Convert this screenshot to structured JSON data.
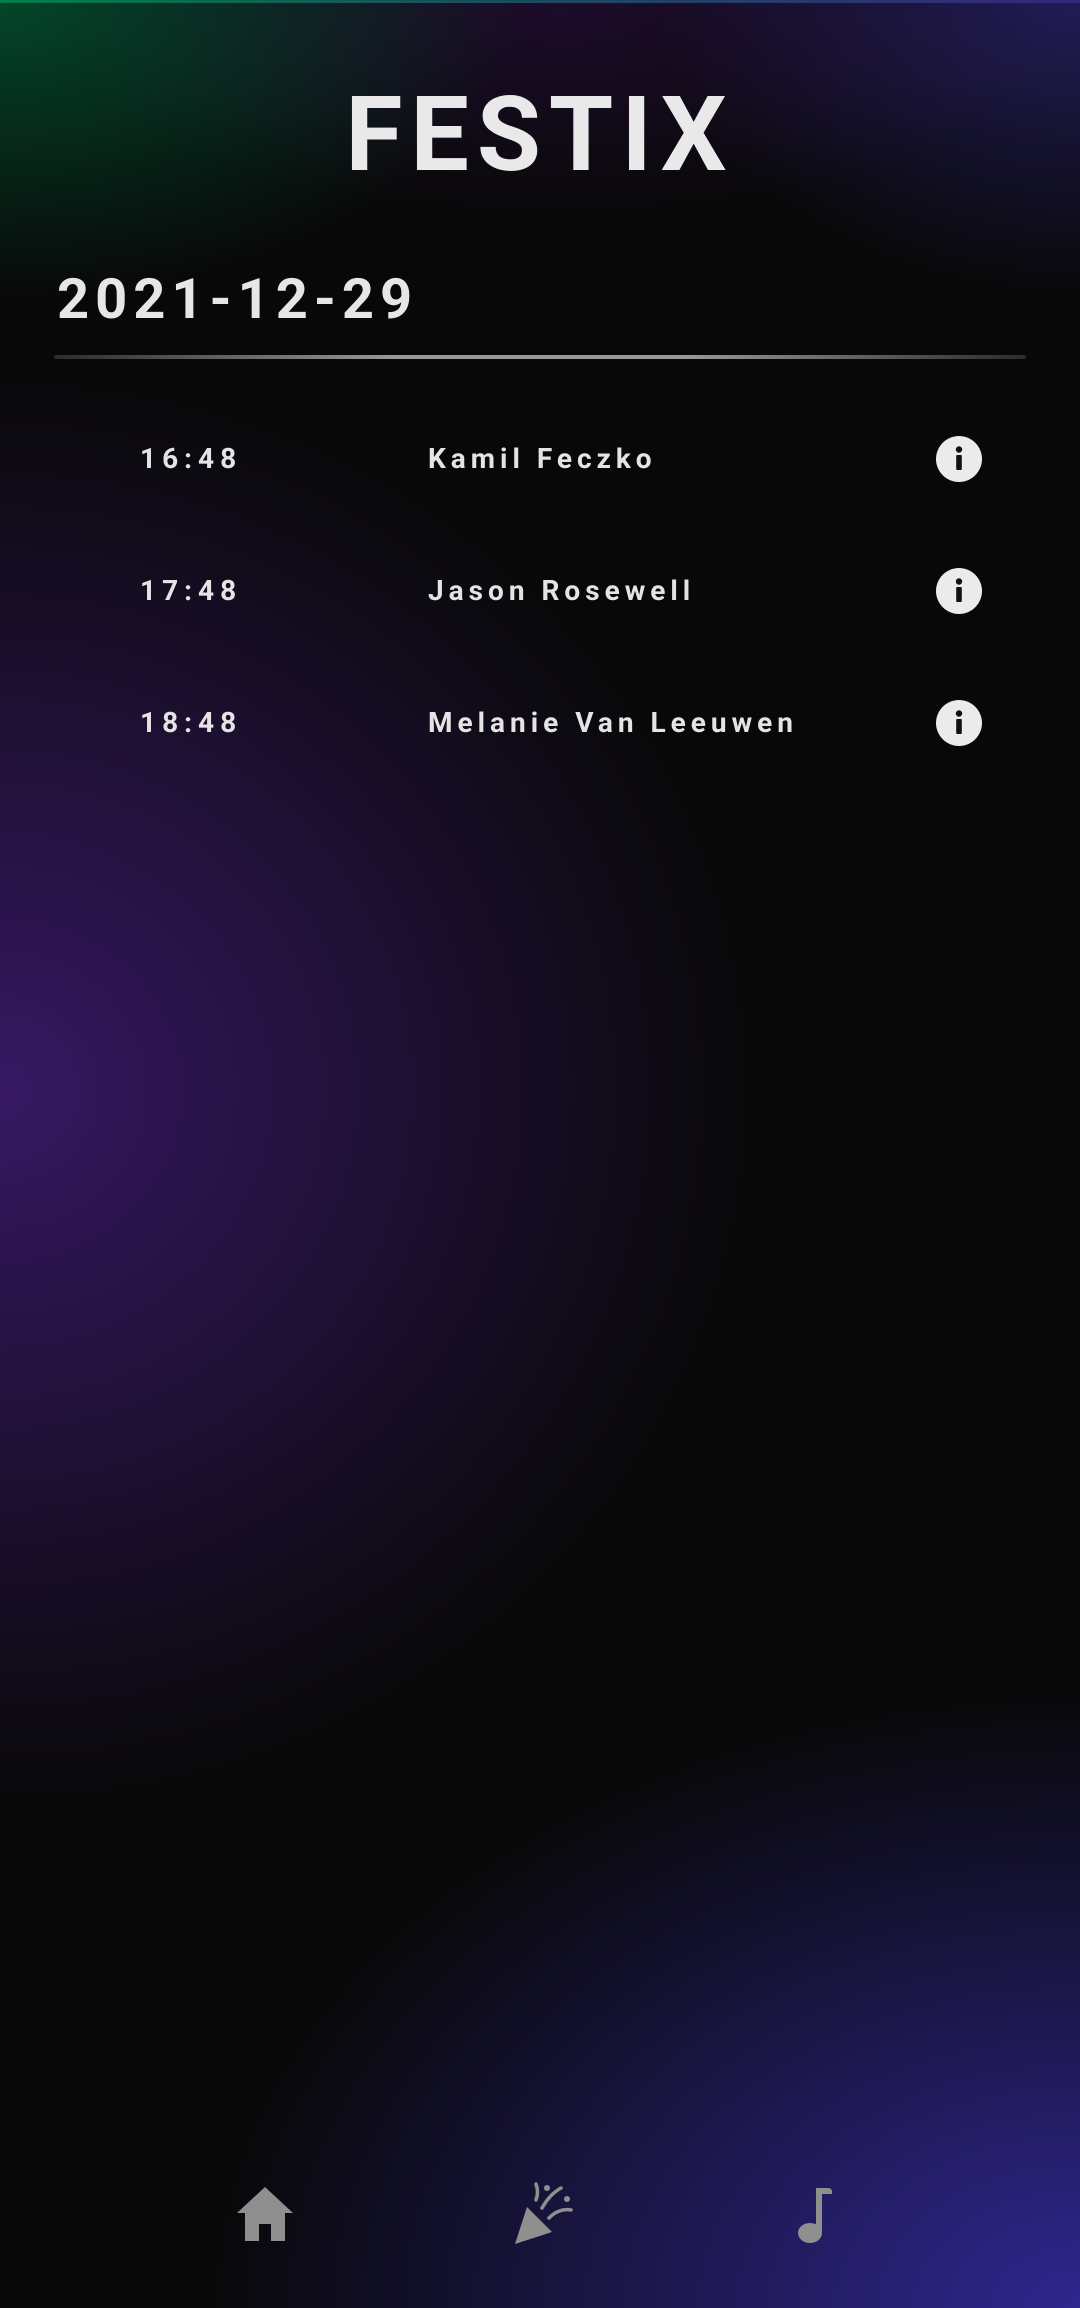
{
  "app": {
    "title": "FESTIX"
  },
  "schedule": {
    "date": "2021-12-29",
    "entries": [
      {
        "time": "16:48",
        "artist": "Kamil Feczko"
      },
      {
        "time": "17:48",
        "artist": "Jason Rosewell"
      },
      {
        "time": "18:48",
        "artist": "Melanie Van Leeuwen"
      }
    ]
  },
  "nav": {
    "items": [
      {
        "icon": "home-icon"
      },
      {
        "icon": "party-popper-icon"
      },
      {
        "icon": "music-note-icon"
      }
    ]
  },
  "colors": {
    "background": "#080808",
    "text": "#e6e6e6",
    "nav_icon": "#8f8f8f",
    "glow_green": "#007846",
    "glow_purple": "#461e82",
    "glow_blue": "#322896"
  }
}
